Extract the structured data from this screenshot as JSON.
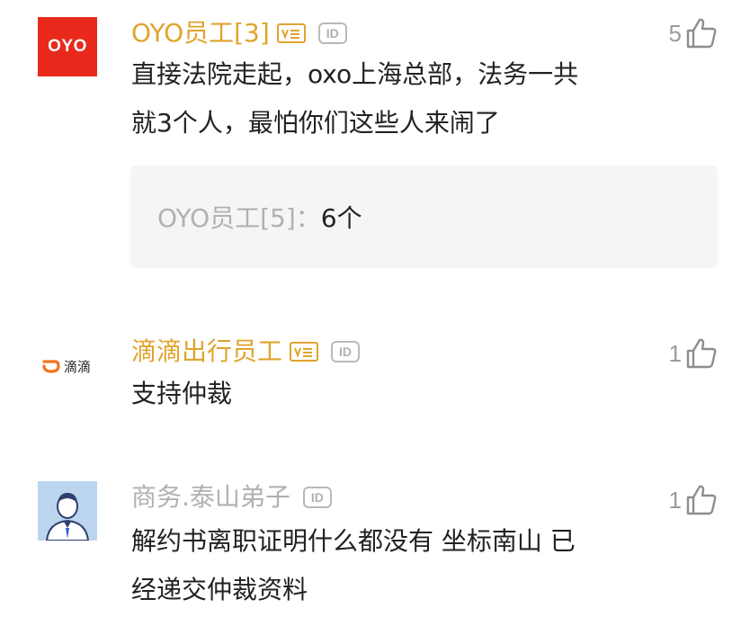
{
  "comments": [
    {
      "avatar_text": "OYO",
      "name": "OYO员工[3]",
      "likes": "5",
      "text_line1": "直接法院走起，oxo上海总部，法务一共",
      "text_line2": "就3个人，最怕你们这些人来闹了",
      "reply": {
        "name": "OYO员工[5]：",
        "text": "6个"
      }
    },
    {
      "avatar_text": "滴滴",
      "name": "滴滴出行员工",
      "likes": "1",
      "text_line1": "支持仲裁"
    },
    {
      "name": "商务.泰山弟子",
      "likes": "1",
      "text_line1": "解约书离职证明什么都没有 坐标南山 已",
      "text_line2": "经递交仲裁资料"
    }
  ],
  "badges": {
    "id_label": "ID"
  },
  "colors": {
    "gold": "#e0a42c",
    "oyo_red": "#e8291c",
    "didi_orange": "#f5731f"
  }
}
